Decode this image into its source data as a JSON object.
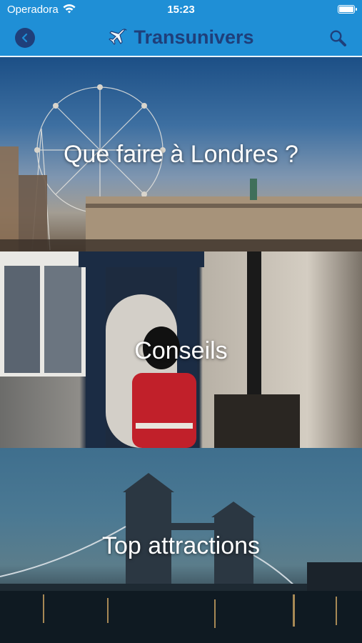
{
  "status_bar": {
    "carrier": "Operadora",
    "time": "15:23",
    "battery_level": 1.0
  },
  "nav": {
    "title": "Transunivers",
    "back_icon": "chevron-left-icon",
    "logo_icon": "airplane-icon",
    "search_icon": "search-icon"
  },
  "colors": {
    "nav_background": "#1f8fd6",
    "brand_dark_blue": "#1f3f7a"
  },
  "tiles": [
    {
      "label": "Que faire à Londres ?",
      "image": "London Eye and County Hall at dusk"
    },
    {
      "label": "Conseils",
      "image": "Royal guard in red tunic and bearskin in sentry box"
    },
    {
      "label": "Top attractions",
      "image": "Tower Bridge at twilight"
    }
  ]
}
